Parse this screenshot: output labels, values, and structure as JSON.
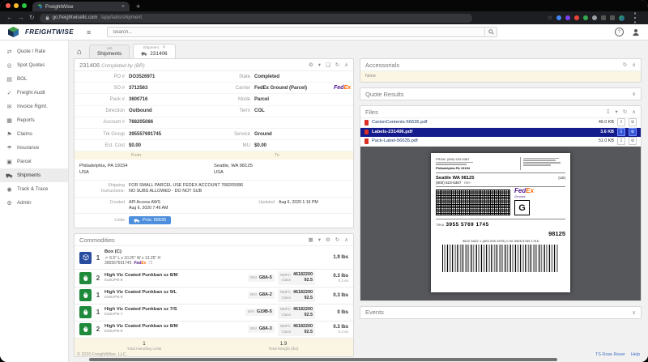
{
  "icons": {
    "home": "⌂",
    "close": "×",
    "caret": "▾",
    "chevron_up": "∧",
    "chevron_down": "∨",
    "refresh": "↻",
    "download": "↧",
    "settings": "⚙",
    "print": "❑",
    "grid": "▦",
    "hamburger": "≡",
    "help": "?",
    "star": "☆",
    "back": "←",
    "forward": "→",
    "menu": "⋮",
    "plus": "+",
    "copy": "❐",
    "dims": "↗"
  },
  "browser": {
    "tab_title": "FreightWise",
    "url_host": "go.freightwisellc.com",
    "url_path": "/app/tabs/shipment"
  },
  "appbar": {
    "brand": "FREIGHTWISE",
    "search_placeholder": "Search..."
  },
  "sidebar": {
    "items": [
      {
        "icon": "⇄",
        "label": "Quote / Rate"
      },
      {
        "icon": "◎",
        "label": "Spot Quotes"
      },
      {
        "icon": "▤",
        "label": "BOL"
      },
      {
        "icon": "✓",
        "label": "Freight Audit"
      },
      {
        "icon": "✉",
        "label": "Invoice Rgmt."
      },
      {
        "icon": "▦",
        "label": "Reports"
      },
      {
        "icon": "⚑",
        "label": "Claims"
      },
      {
        "icon": "☂",
        "label": "Insurance"
      },
      {
        "icon": "▣",
        "label": "Parcel"
      },
      {
        "icon": "",
        "label": "Shipments"
      },
      {
        "icon": "◉",
        "label": "Track & Trace"
      },
      {
        "icon": "⚙",
        "label": "Admin"
      }
    ]
  },
  "tabs": {
    "list_top": "List",
    "list_label": "Shipments",
    "ship_top": "Shipment",
    "ship_label": "231406"
  },
  "shipment": {
    "title": "231406",
    "subtitle": "Completed by (BR)",
    "fields": [
      {
        "l": "PO #",
        "v": "DO3526971",
        "l2": "State",
        "v2": "Completed"
      },
      {
        "l": "SO #",
        "v": "3712563",
        "l2": "Carrier",
        "v2": "FedEx Ground (Parcel)"
      },
      {
        "l": "Pack #",
        "v": "3600716",
        "l2": "Mode",
        "v2": "Parcel"
      },
      {
        "l": "Direction",
        "v": "Outbound",
        "l2": "Term",
        "v2": "COL"
      },
      {
        "l": "Account #",
        "v": "768205086",
        "l2": "",
        "v2": ""
      },
      {
        "l": "Trk Group",
        "v": "395557691745",
        "l2": "Service",
        "v2": "Ground"
      },
      {
        "l": "Est. Cost",
        "v": "$0.00",
        "l2": "MU",
        "v2": "$0.00"
      }
    ],
    "fedex_fed": "Fed",
    "fedex_ex": "Ex",
    "from_label": "From",
    "to_label": "To",
    "from_line1": "Philadelphia, PA 19154",
    "from_line2": "USA",
    "to_line1": "Seattle, WA 98125",
    "to_line2": "USA",
    "instr_label1": "Shipping",
    "instr_label2": "Instructions:",
    "instr_line1": "FOR SMALL PARCEL USE FEDEX ACCOUNT 768205086",
    "instr_line2": "NO SUBS ALLOWED - DO NOT SUB",
    "created_label": "Created",
    "created_by": "API Access AWS",
    "created_at": "Aug 6, 2020 7:46 AM",
    "updated_label": "Updated",
    "updated_at": "Aug 6, 2020 1:16 PM",
    "links_label": "Links",
    "links_button": "Pcls: 56635"
  },
  "commodities": {
    "title": "Commodities",
    "box": {
      "qty": "1",
      "name": "Box (C)",
      "dims": "6.5\" L x 10.25\" W x 13.25\" H",
      "tracking": "395557691745",
      "weight": "1.9 lbs"
    },
    "labels": {
      "bin": "BIN",
      "nmfc": "NMFC",
      "class": "Class"
    },
    "rows": [
      {
        "qty": "2",
        "name": "High Viz Coated Punkban sz 8/M",
        "sku": "516UPN-8",
        "bin": "G8A-5",
        "nmfc": "46182200",
        "class": "92.5",
        "weight": "0.3 lbs",
        "each": "0.2 ea"
      },
      {
        "qty": "1",
        "name": "High Viz Coated Punkban sz 9/L",
        "sku": "516UPN-9",
        "bin": "G8A-2",
        "nmfc": "46182200",
        "class": "92.5",
        "weight": "0.3 lbs",
        "each": ""
      },
      {
        "qty": "1",
        "name": "High Viz Coated Punkban sz 7/S",
        "sku": "516UPN-7",
        "bin": "G19B-5",
        "nmfc": "46182200",
        "class": "92.5",
        "weight": "0 lbs",
        "each": ""
      },
      {
        "qty": "2",
        "name": "High Viz Coated Punkban sz 8/M",
        "sku": "516UPN-8",
        "bin": "G8A-3",
        "nmfc": "46182200",
        "class": "92.5",
        "weight": "0.3 lbs",
        "each": "0.2 ea"
      }
    ],
    "totals": {
      "units": "1",
      "units_label": "Total Handling Units",
      "weight": "1.9",
      "weight_label": "Total Weight (lbs)"
    }
  },
  "panels": {
    "accessorials": {
      "title": "Accessorials",
      "body": "None"
    },
    "quote_results": {
      "title": "Quote Results"
    },
    "files": {
      "title": "Files",
      "rows": [
        {
          "name": "CartonContents-56635.pdf",
          "size": "46.0 KB"
        },
        {
          "name": "Labels-231406.pdf",
          "size": "3.6 KB"
        },
        {
          "name": "Pack-Label-56635.pdf",
          "size": "51.0 KB"
        }
      ]
    },
    "events": {
      "title": "Events"
    }
  },
  "label_preview": {
    "from_label": "FROM",
    "from_phone": "(800) 523-5367",
    "origin": "Philadelphia PA 19154",
    "dest_city": "Seattle WA 98125",
    "dest_phone": "(800) 523-5367",
    "country": "(US)",
    "ref": "REF:",
    "fedex_fed": "Fed",
    "fedex_ex": "Ex",
    "fedex_service": "Ground",
    "service_letter": "G",
    "trk_label": "TRK#",
    "trk_number": "3955 5769 1745",
    "zip": "98125",
    "barcode_digits": "9622 5422 1 (000 000 2975) 0 00 3955 5769 1745"
  },
  "footer": {
    "copyright": "© 2020 FreightWise, LLC.",
    "user_link": "TS Rose Reser",
    "help_link": "Help"
  },
  "colors": {
    "accent_blue": "#4d8fdc",
    "selected_navy": "#141b8c",
    "fedex_purple": "#4d148c",
    "fedex_orange": "#ff6600",
    "panel_tan": "#fbf6e3",
    "item_green": "#1f8a3b",
    "box_blue": "#274b9f"
  }
}
